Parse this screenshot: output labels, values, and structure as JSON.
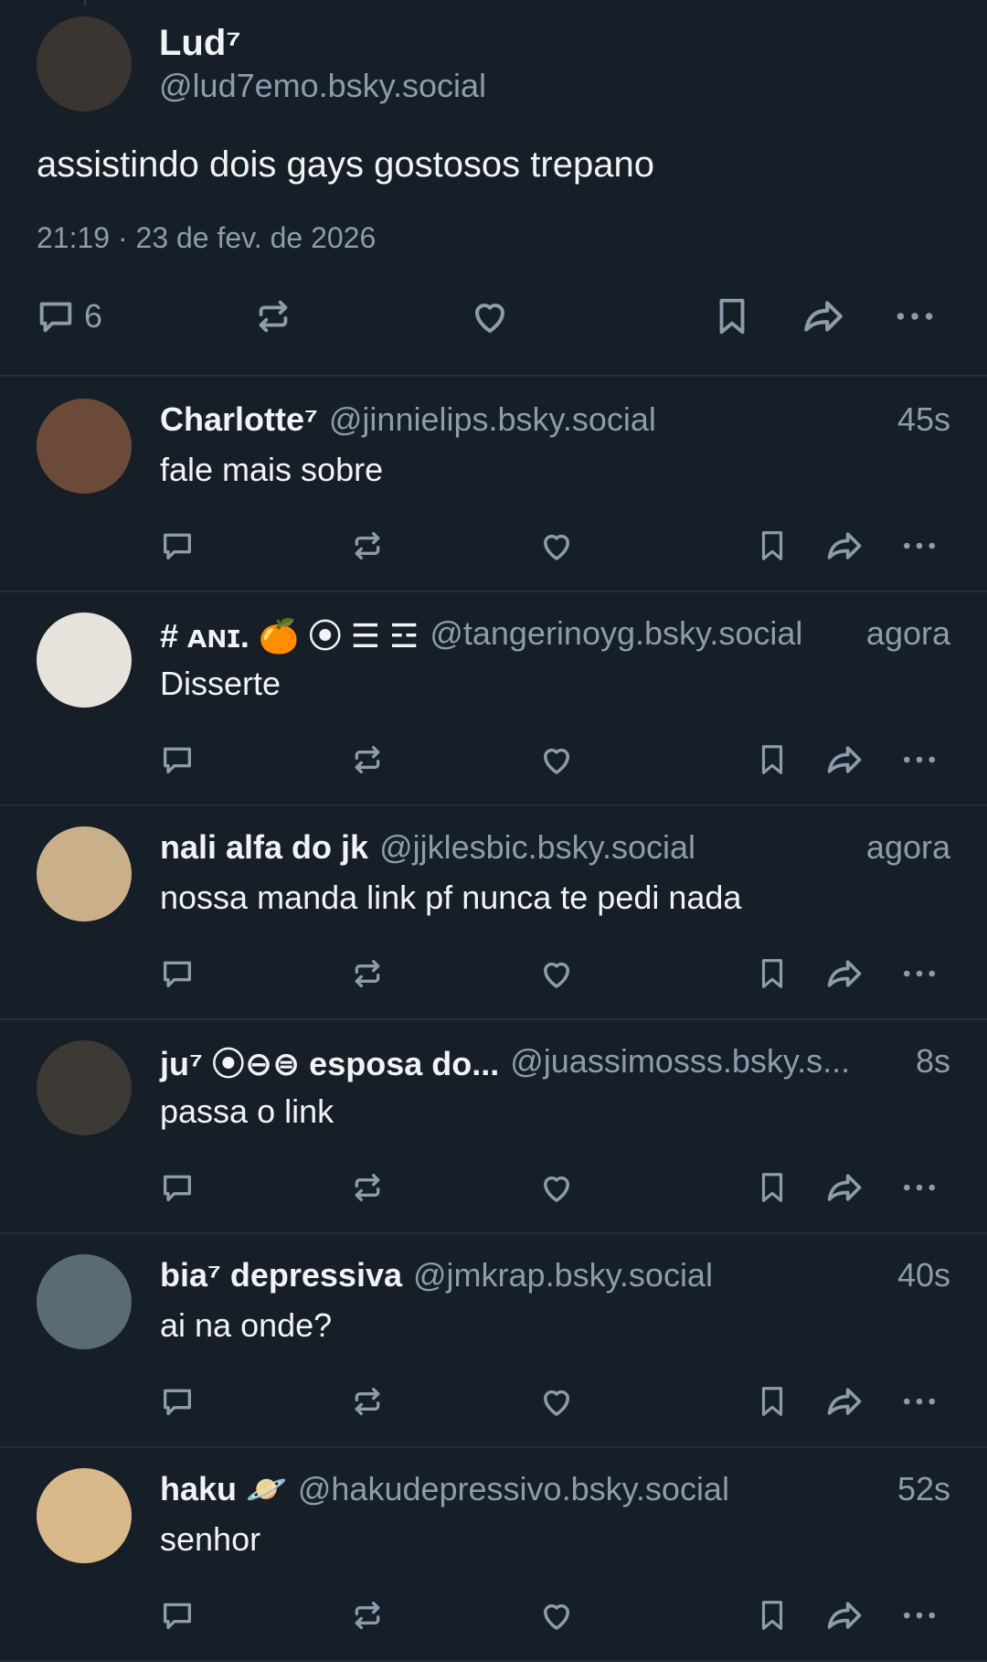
{
  "main_post": {
    "display_name": "Lud⁷",
    "handle": "@lud7emo.bsky.social",
    "text": "assistindo dois gays gostosos trepano",
    "timestamp": "21:19 · 23 de fev. de 2026",
    "reply_count": "6",
    "avatar_color": "#3a3530"
  },
  "replies": [
    {
      "display_name": "Charlotte⁷",
      "handle": "@jinnielips.bsky.social",
      "time": "45s",
      "text": "fale mais sobre",
      "avatar_color": "#6b4a3a"
    },
    {
      "display_name": "# ᴀɴɪ. 🍊 ⦿ ☰ ☲",
      "handle": "@tangerinoyg.bsky.social",
      "time": "agora",
      "text": "Disserte",
      "avatar_color": "#e8e2dc"
    },
    {
      "display_name": "nali alfa do jk",
      "handle": "@jjklesbic.bsky.social",
      "time": "agora",
      "text": "nossa manda link pf nunca te pedi nada",
      "avatar_color": "#c9b08a"
    },
    {
      "display_name": "ju⁷ ⦿⊖⊜ esposa do...",
      "handle": "@juassimosss.bsky.s...",
      "time": "8s",
      "text": "passa o link",
      "avatar_color": "#3d3a35"
    },
    {
      "display_name": "bia⁷ depressiva",
      "handle": "@jmkrap.bsky.social",
      "time": "40s",
      "text": "ai na onde?",
      "avatar_color": "#5b6b73"
    },
    {
      "display_name": "haku 🪐",
      "handle": "@hakudepressivo.bsky.social",
      "time": "52s",
      "text": "senhor",
      "avatar_color": "#d9b98a"
    }
  ],
  "icons": [
    "reply-icon",
    "repost-icon",
    "like-icon",
    "bookmark-icon",
    "share-icon",
    "more-icon"
  ],
  "colors": {
    "background": "#161e27",
    "text": "#f1f3f5",
    "muted": "#8d9cad",
    "divider": "#232e3a"
  }
}
